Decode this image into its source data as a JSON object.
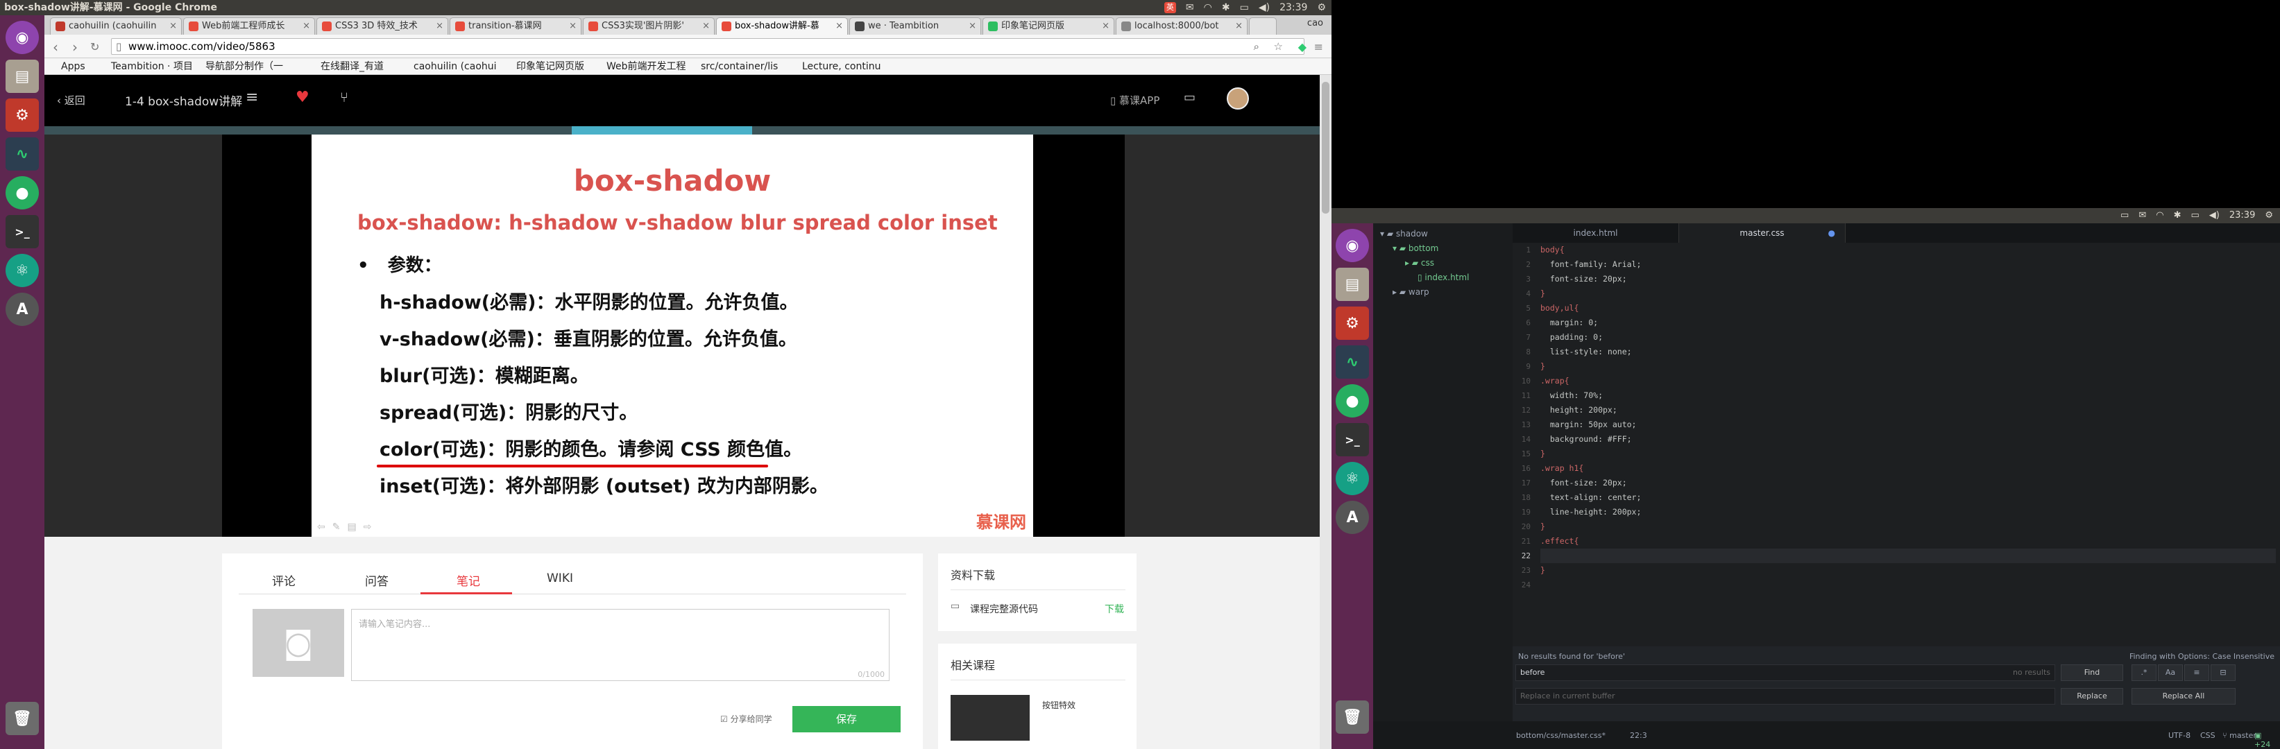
{
  "left_screen": {
    "window_title": "box-shadow讲解-慕课网 - Google Chrome",
    "clock": "23:39",
    "tray_keyboard_label": "cao",
    "tabs": [
      {
        "label": "caohuilin (caohuilin",
        "color": "#c0392b"
      },
      {
        "label": "Web前端工程师成长",
        "color": "#e74c3c"
      },
      {
        "label": "CSS3 3D 特效_技术",
        "color": "#e74c3c"
      },
      {
        "label": "transition-慕课网",
        "color": "#e74c3c"
      },
      {
        "label": "CSS3实现'图片阴影'",
        "color": "#e74c3c"
      },
      {
        "label": "box-shadow讲解-慕",
        "color": "#e74c3c"
      },
      {
        "label": "we · Teambition",
        "color": "#444444"
      },
      {
        "label": "印象笔记网页版",
        "color": "#2dbe60"
      },
      {
        "label": "localhost:8000/bot",
        "color": "#888888"
      }
    ],
    "url": "www.imooc.com/video/5863",
    "bookmarks": [
      "Apps",
      "Teambition · 项目",
      "导航部分制作（一",
      "在线翻译_有道",
      "caohuilin (caohui",
      "印象笔记网页版",
      "Web前端开发工程",
      "src/container/lis",
      "Lecture, continu"
    ],
    "site": {
      "back_label": "返回",
      "lesson_title": "1-4 box-shadow讲解",
      "app_label": "慕课APP",
      "accent": "#e8383d"
    },
    "slide": {
      "title": "box-shadow",
      "syntax": "box-shadow: h-shadow v-shadow blur spread color inset",
      "bullet": "参数：",
      "lines": [
        "h-shadow(必需)：水平阴影的位置。允许负值。",
        "v-shadow(必需)：垂直阴影的位置。允许负值。",
        "blur(可选)：模糊距离。",
        "spread(可选)：阴影的尺寸。",
        "color(可选)：阴影的颜色。请参阅 CSS 颜色值。",
        "inset(可选)：将外部阴影 (outset) 改为内部阴影。"
      ],
      "logo": "慕课网",
      "title_color": "#d9534f"
    },
    "content_tabs": [
      "评论",
      "问答",
      "笔记",
      "WIKI"
    ],
    "active_tab": "笔记",
    "note": {
      "placeholder": "请输入笔记内容...",
      "counter": "0/1000",
      "share_label": "分享给同学",
      "save_label": "保存"
    },
    "downloads": {
      "title": "资料下载",
      "item": "课程完整源代码",
      "action": "下载"
    },
    "related": {
      "title": "相关课程",
      "item": "按钮特效"
    }
  },
  "right_screen": {
    "clock": "23:39",
    "tree": [
      {
        "label": "shadow",
        "level": 0,
        "type": "folder"
      },
      {
        "label": "bottom",
        "level": 1,
        "type": "folder"
      },
      {
        "label": "css",
        "level": 2,
        "type": "folder"
      },
      {
        "label": "index.html",
        "level": 2,
        "type": "file"
      },
      {
        "label": "warp",
        "level": 1,
        "type": "folder"
      }
    ],
    "editor_tabs": [
      "index.html",
      "master.css"
    ],
    "active_editor_tab": "master.css",
    "code_lines": [
      "body{",
      "  font-family: Arial;",
      "  font-size: 20px;",
      "}",
      "body,ul{",
      "  margin: 0;",
      "  padding: 0;",
      "  list-style: none;",
      "}",
      ".wrap{",
      "  width: 70%;",
      "  height: 200px;",
      "  margin: 50px auto;",
      "  background: #FFF;",
      "}",
      ".wrap h1{",
      "  font-size: 20px;",
      "  text-align: center;",
      "  line-height: 200px;",
      "}",
      ".effect{",
      "",
      "}",
      ""
    ],
    "find": {
      "message": "No results found for 'before'",
      "options": "Finding with Options: Case Insensitive",
      "query": "before",
      "results": "no results",
      "find_label": "Find",
      "replace_placeholder": "Replace in current buffer",
      "replace_label": "Replace",
      "replace_all_label": "Replace All"
    },
    "status": {
      "path": "bottom/css/master.css*",
      "cursor": "22:3",
      "encoding": "UTF-8",
      "grammar": "CSS",
      "branch": "master",
      "changes": "+24"
    }
  }
}
